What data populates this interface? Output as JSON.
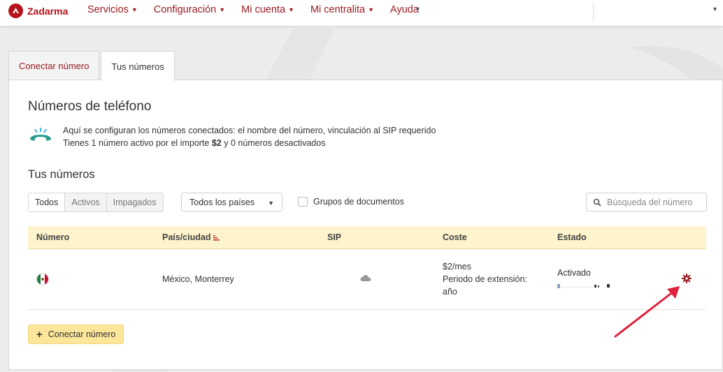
{
  "brand": {
    "name": "Zadarma",
    "color": "#b5121b"
  },
  "nav": {
    "items": [
      {
        "label": "Servicios"
      },
      {
        "label": "Configuración"
      },
      {
        "label": "Mi cuenta"
      },
      {
        "label": "Mi centralita"
      },
      {
        "label": "Ayuda"
      }
    ]
  },
  "tabs": [
    {
      "label": "Conectar número",
      "active": false
    },
    {
      "label": "Tus números",
      "active": true
    }
  ],
  "page": {
    "title": "Números de teléfono",
    "info_line1": "Aquí se configuran los números conectados: el nombre del número, vinculación al SIP requerido",
    "info_line2_prefix": "Tienes 1 número activo por el importe ",
    "info_line2_amount": "$2",
    "info_line2_suffix": " y 0 números desactivados",
    "section_title": "Tus números"
  },
  "filters": {
    "segments": [
      {
        "label": "Todos",
        "active": true
      },
      {
        "label": "Activos",
        "active": false
      },
      {
        "label": "Impagados",
        "active": false
      }
    ],
    "country_select": "Todos los países",
    "documents_checkbox_label": "Grupos de documentos",
    "documents_checkbox_checked": false,
    "search_placeholder": "Búsqueda del número"
  },
  "table": {
    "headers": {
      "number": "Número",
      "country": "País/ciudad",
      "sip": "SIP",
      "cost": "Coste",
      "status": "Estado"
    },
    "rows": [
      {
        "flag": "mexico",
        "country": "México, Monterrey",
        "sip_icon": "cloud-icon",
        "cost_line1": "$2/mes",
        "cost_line2": "Periodo de extensión:",
        "cost_line3": "año",
        "status": "Activado"
      }
    ]
  },
  "actions": {
    "connect_label": "Conectar número"
  },
  "colors": {
    "accent": "#9a1b22",
    "header_bg": "#fdf3cc",
    "button_bg": "#fbe69a",
    "arrow": "#e0203a",
    "icon_teal": "#2a9d8f"
  }
}
